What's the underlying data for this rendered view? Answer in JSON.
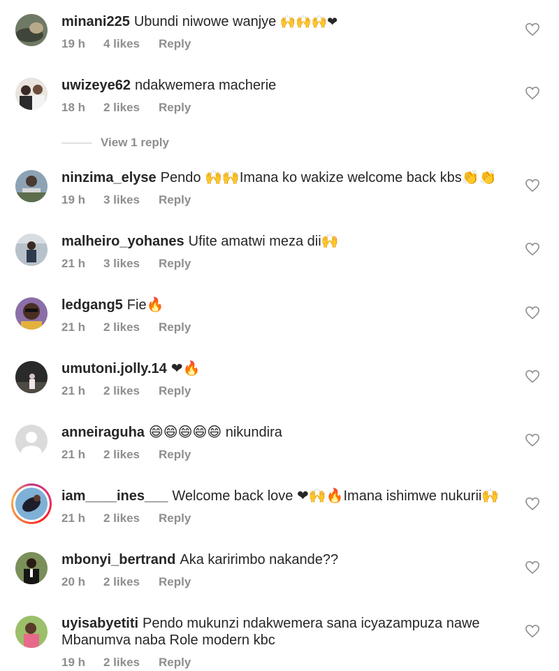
{
  "comments": [
    {
      "user": "minani225",
      "text": "Ubundi niwowe wanjye",
      "emoji": "🙌🙌🙌❤",
      "time": "19 h",
      "likes": "4 likes",
      "reply": "Reply"
    },
    {
      "user": "uwizeye62",
      "text": "ndakwemera macherie",
      "emoji": "",
      "time": "18 h",
      "likes": "2 likes",
      "reply": "Reply"
    },
    {
      "user": "ninzima_elyse",
      "text": "Pendo 🙌🙌Imana ko wakize welcome back kbs👏👏",
      "emoji": "",
      "time": "19 h",
      "likes": "3 likes",
      "reply": "Reply"
    },
    {
      "user": "malheiro_yohanes",
      "text": "Ufite amatwi meza dii🙌",
      "emoji": "",
      "time": "21 h",
      "likes": "3 likes",
      "reply": "Reply"
    },
    {
      "user": "ledgang5",
      "text": "Fie🔥",
      "emoji": "",
      "time": "21 h",
      "likes": "2 likes",
      "reply": "Reply"
    },
    {
      "user": "umutoni.jolly.14",
      "text": "❤🔥",
      "emoji": "",
      "time": "21 h",
      "likes": "2 likes",
      "reply": "Reply"
    },
    {
      "user": "anneiraguha",
      "text": "😄😄😄😄😄 nikundira",
      "emoji": "",
      "time": "21 h",
      "likes": "2 likes",
      "reply": "Reply"
    },
    {
      "user": "iam____ines___",
      "text": "Welcome back love ❤🙌🔥Imana ishimwe nukurii🙌",
      "emoji": "",
      "time": "21 h",
      "likes": "2 likes",
      "reply": "Reply"
    },
    {
      "user": "mbonyi_bertrand",
      "text": "Aka karirimbo nakande??",
      "emoji": "",
      "time": "20 h",
      "likes": "2 likes",
      "reply": "Reply"
    },
    {
      "user": "uyisabyetiti",
      "text": "Pendo mukunzi ndakwemera sana icyazampuza nawe Mbanumva naba Role modern  kbc",
      "emoji": "",
      "time": "19 h",
      "likes": "2 likes",
      "reply": "Reply"
    }
  ],
  "view_reply": "View 1 reply",
  "icons": {
    "like": "heart-outline-icon"
  }
}
